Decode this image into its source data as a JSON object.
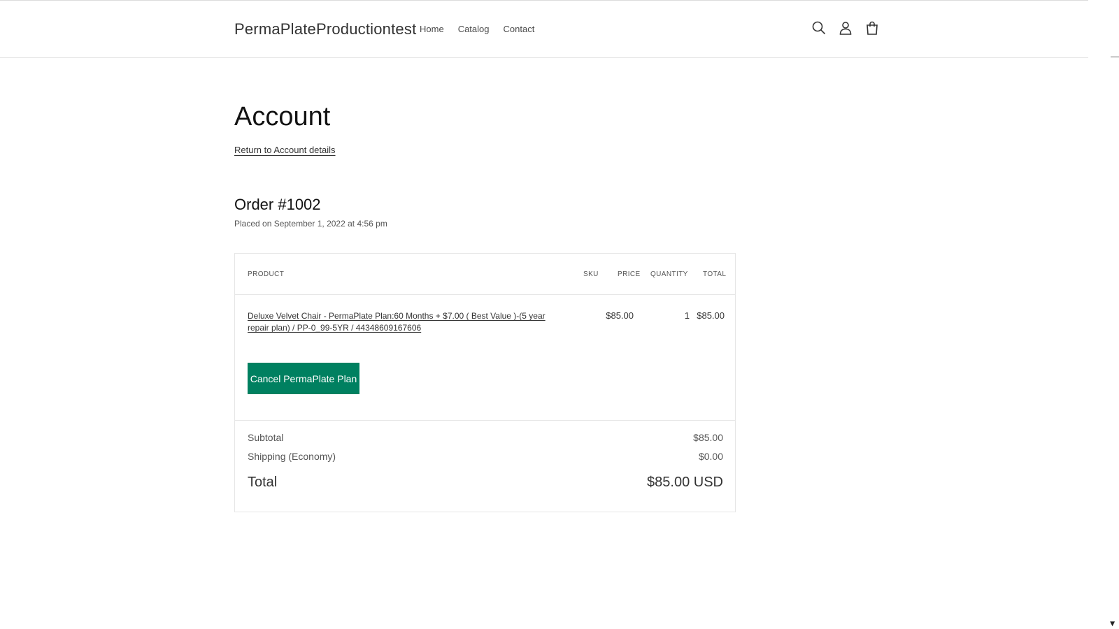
{
  "header": {
    "brand": "PermaPlateProductiontest",
    "nav": [
      {
        "label": "Home"
      },
      {
        "label": "Catalog"
      },
      {
        "label": "Contact"
      }
    ],
    "icons": [
      "search-icon",
      "account-icon",
      "cart-icon"
    ]
  },
  "page": {
    "title": "Account",
    "return_link": "Return to Account details"
  },
  "order": {
    "title": "Order #1002",
    "placed_on": "Placed on September 1, 2022 at 4:56 pm",
    "table": {
      "headers": {
        "product": "PRODUCT",
        "sku": "SKU",
        "price": "PRICE",
        "quantity": "QUANTITY",
        "total": "TOTAL"
      },
      "rows": [
        {
          "product": "Deluxe Velvet Chair - PermaPlate Plan:60 Months + $7.00 ( Best Value )-(5 year repair plan) / PP-0_99-5YR / 44348609167606",
          "sku": "",
          "price": "$85.00",
          "quantity": "1",
          "total": "$85.00",
          "action_label": "Cancel PermaPlate Plan"
        }
      ]
    },
    "summary": {
      "subtotal_label": "Subtotal",
      "subtotal_value": "$85.00",
      "shipping_label": "Shipping (Economy)",
      "shipping_value": "$0.00",
      "total_label": "Total",
      "total_value": "$85.00 USD"
    }
  },
  "colors": {
    "accent": "#008060",
    "border": "#e6e6e6",
    "text": "#121212"
  }
}
